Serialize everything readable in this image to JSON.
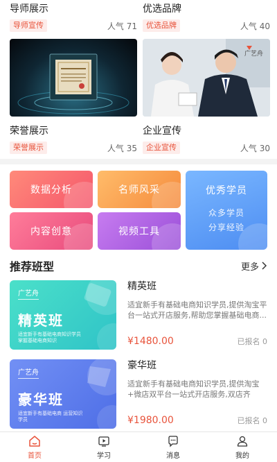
{
  "top_cards": [
    {
      "title": "导师展示",
      "tag": "导师宣传",
      "popularity": "人气 71"
    },
    {
      "title": "优选品牌",
      "tag": "优选品牌",
      "popularity": "人气 40"
    },
    {
      "title": "荣誉展示",
      "tag": "荣誉展示",
      "popularity": "人气 35"
    },
    {
      "title": "企业宣传",
      "tag": "企业宣传",
      "popularity": "人气 30"
    }
  ],
  "thumb_brand": "广艺舟",
  "features": {
    "data_analysis": "数据分析",
    "teacher_style": "名师风采",
    "content_creative": "内容创意",
    "video_tools": "视频工具",
    "excellent_students": "优秀学员",
    "students_line1": "众多学员",
    "students_line2": "分享经验"
  },
  "section": {
    "title": "推荐班型",
    "more": "更多"
  },
  "courses": [
    {
      "cover_brand": "广艺舟",
      "cover_name": "精英班",
      "cover_desc": "适宜新手有基础电商知识学员 掌握基础电商知识",
      "name": "精英班",
      "description": "适宜新手有基础电商知识学员,提供淘宝平台一站式开店服务,帮助您掌握基础电商...",
      "price": "¥1480.00",
      "enrolled": "已报名 0"
    },
    {
      "cover_brand": "广艺舟",
      "cover_name": "豪华班",
      "cover_desc": "适宜新手有基础电商 运营知识学员",
      "name": "豪华班",
      "description": "适宜新手有基础电商知识学员,提供淘宝+微店双平台一站式开店服务,双店齐开,...",
      "price": "¥1980.00",
      "enrolled": "已报名 0"
    }
  ],
  "tabbar": [
    {
      "label": "首页",
      "icon": "home-icon",
      "active": true
    },
    {
      "label": "学习",
      "icon": "play-icon",
      "active": false
    },
    {
      "label": "消息",
      "icon": "chat-icon",
      "active": false
    },
    {
      "label": "我的",
      "icon": "user-icon",
      "active": false
    }
  ],
  "colors": {
    "accent": "#e8533b",
    "tile_data": "#f86b6b",
    "tile_teacher": "#f7a04a",
    "tile_content": "#f5637f",
    "tile_video": "#b05ae0",
    "tile_students": "#5a9bf8",
    "cover_elite": "#3fd6c4",
    "cover_luxury": "#5b7bf0"
  }
}
